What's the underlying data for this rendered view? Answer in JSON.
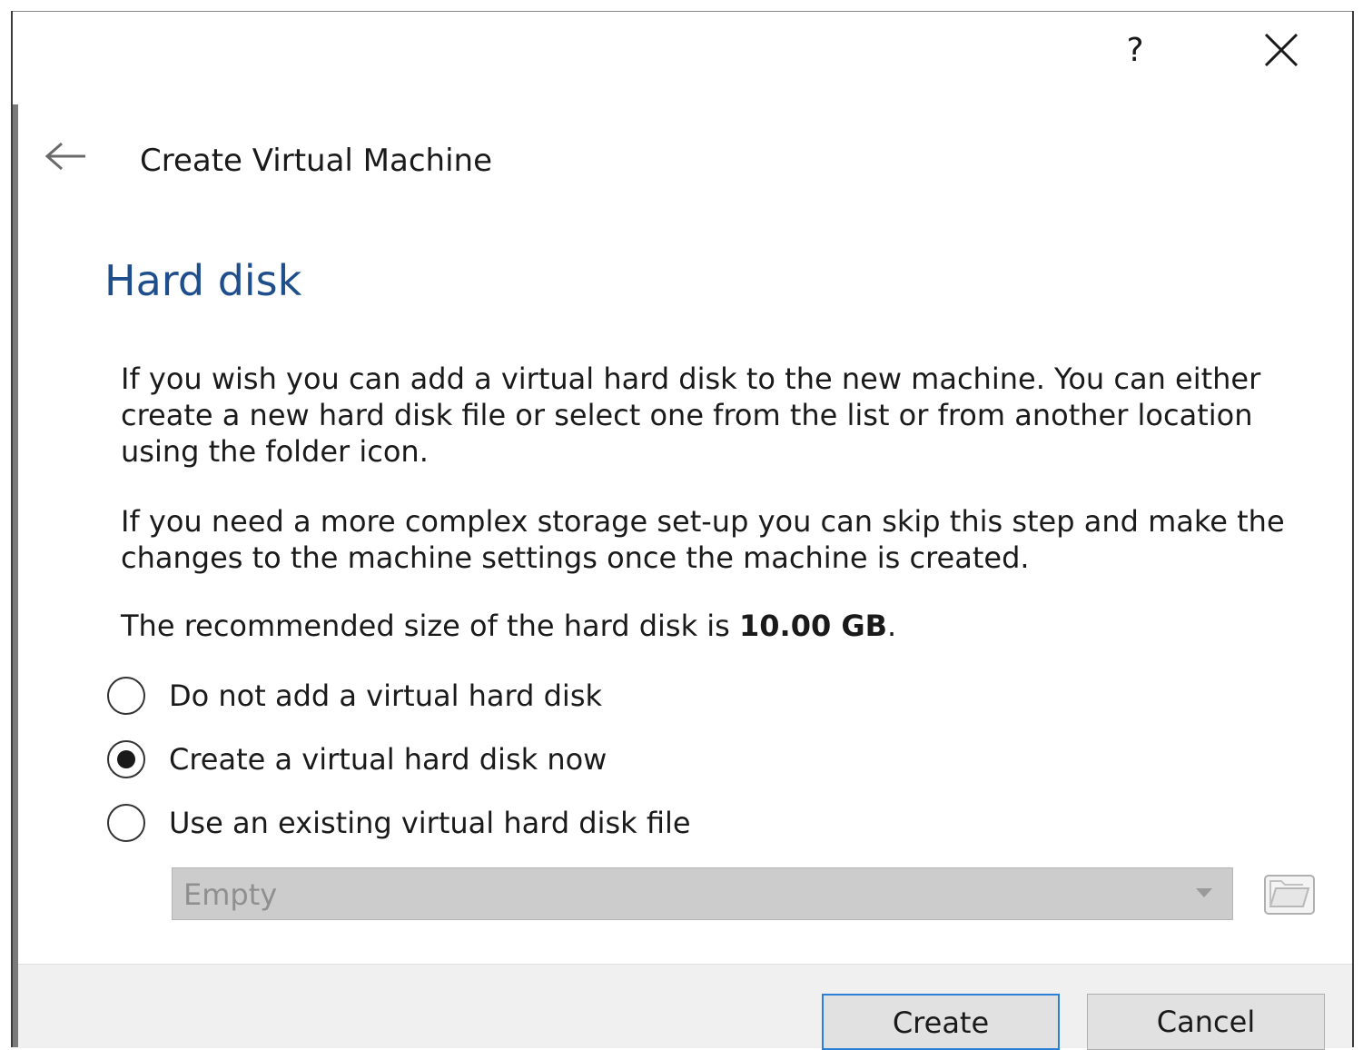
{
  "titlebar": {
    "help_label": "?",
    "help_icon": "question-mark-icon",
    "close_icon": "close-icon"
  },
  "header": {
    "back_icon": "back-arrow-icon",
    "title": "Create Virtual Machine"
  },
  "page": {
    "heading": "Hard disk",
    "paragraph1": "If you wish you can add a virtual hard disk to the new machine. You can either create a new hard disk file or select one from the list or from another location using the folder icon.",
    "paragraph2": "If you need a more complex storage set-up you can skip this step and make the changes to the machine settings once the machine is created.",
    "recommended_prefix": "The recommended size of the hard disk is ",
    "recommended_size": "10.00 GB",
    "recommended_suffix": "."
  },
  "options": [
    {
      "label": "Do not add a virtual hard disk",
      "checked": false
    },
    {
      "label": "Create a virtual hard disk now",
      "checked": true
    },
    {
      "label": "Use an existing virtual hard disk file",
      "checked": false
    }
  ],
  "disk_select": {
    "value": "Empty",
    "enabled": false,
    "folder_icon": "folder-icon"
  },
  "footer": {
    "create_label": "Create",
    "cancel_label": "Cancel"
  },
  "colors": {
    "heading": "#1f4e8c",
    "default_button_border": "#2b7fd6"
  }
}
